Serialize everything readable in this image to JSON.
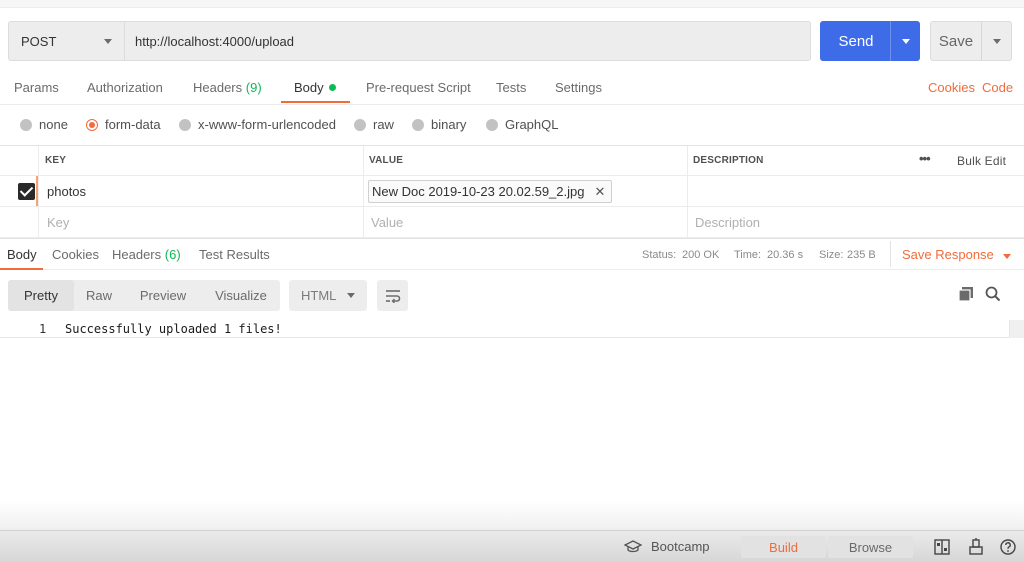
{
  "request": {
    "method": "POST",
    "url": "http://localhost:4000/upload",
    "send_label": "Send",
    "save_label": "Save"
  },
  "req_tabs": {
    "params": "Params",
    "authorization": "Authorization",
    "headers": "Headers",
    "headers_count": "(9)",
    "body": "Body",
    "pre_request": "Pre-request Script",
    "tests": "Tests",
    "settings": "Settings",
    "cookies": "Cookies",
    "code": "Code"
  },
  "body_types": {
    "none": "none",
    "form_data": "form-data",
    "urlencoded": "x-www-form-urlencoded",
    "raw": "raw",
    "binary": "binary",
    "graphql": "GraphQL",
    "selected": "form-data"
  },
  "params_table": {
    "headers": {
      "key": "KEY",
      "value": "VALUE",
      "description": "DESCRIPTION",
      "more": "•••",
      "bulk_edit": "Bulk Edit"
    },
    "rows": [
      {
        "checked": true,
        "key": "photos",
        "value": "New Doc 2019-10-23 20.02.59_2.jpg",
        "remove": "✕"
      }
    ],
    "placeholder": {
      "key": "Key",
      "value": "Value",
      "description": "Description"
    }
  },
  "response": {
    "tabs": {
      "body": "Body",
      "cookies": "Cookies",
      "headers": "Headers",
      "headers_count": "(6)",
      "test_results": "Test Results"
    },
    "status_label": "Status:",
    "status_value": "200 OK",
    "time_label": "Time:",
    "time_value": "20.36 s",
    "size_label": "Size:",
    "size_value": "235 B",
    "save_response": "Save Response",
    "view_modes": {
      "pretty": "Pretty",
      "raw": "Raw",
      "preview": "Preview",
      "visualize": "Visualize"
    },
    "format": "HTML",
    "lines": [
      {
        "number": "1",
        "text": "Successfully uploaded 1 files!"
      }
    ]
  },
  "statusbar": {
    "bootcamp": "Bootcamp",
    "build": "Build",
    "browse": "Browse"
  },
  "colors": {
    "accent": "#f26b3a",
    "send_blue": "#3e6ce8",
    "success_green": "#0cbb52"
  }
}
